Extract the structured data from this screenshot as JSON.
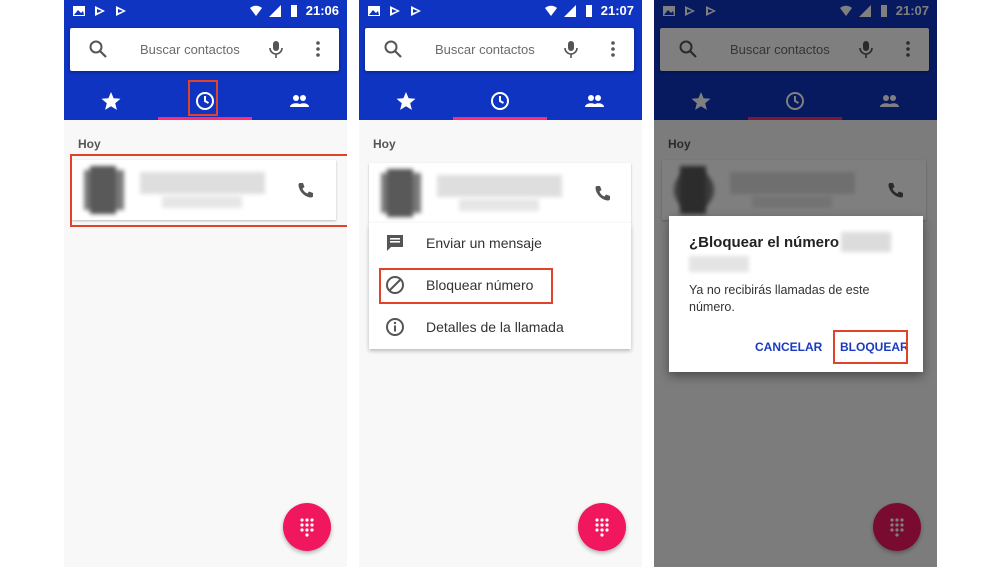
{
  "status_bar": {
    "times": [
      "21:06",
      "21:07",
      "21:07"
    ]
  },
  "search": {
    "placeholder": "Buscar contactos"
  },
  "tabs": [
    {
      "icon": "star-icon"
    },
    {
      "icon": "clock-icon"
    },
    {
      "icon": "people-icon"
    }
  ],
  "call_log": {
    "section": "Hoy"
  },
  "context_menu": {
    "items": [
      {
        "label": "Enviar un mensaje",
        "icon": "message-icon"
      },
      {
        "label": "Bloquear número",
        "icon": "block-icon"
      },
      {
        "label": "Detalles de la llamada",
        "icon": "info-icon"
      }
    ]
  },
  "dialog": {
    "title": "¿Bloquear el número",
    "message": "Ya no recibirás llamadas de este número.",
    "cancel": "CANCELAR",
    "confirm": "BLOQUEAR"
  },
  "colors": {
    "app_bar": "#0e34c1",
    "accent": "#f0175f",
    "tab_indicator": "#ff2b73",
    "highlight": "#e0432a",
    "dialog_button": "#1a3bbf"
  }
}
